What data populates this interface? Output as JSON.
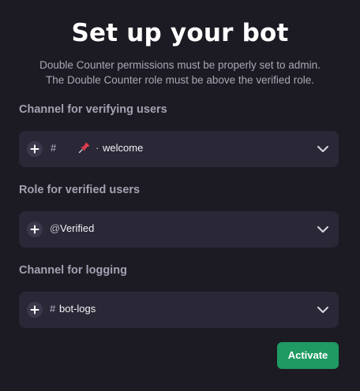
{
  "title": "Set up your bot",
  "description": {
    "line1": "Double Counter permissions must be properly set to admin.",
    "line2": "The Double Counter role must be above the verified role."
  },
  "fields": [
    {
      "label": "Channel for verifying users",
      "prefix": "#",
      "icon": "pushpin-emoji",
      "separator": "·",
      "value": "welcome"
    },
    {
      "label": "Role for verified users",
      "prefix": "@",
      "value": "Verified"
    },
    {
      "label": "Channel for logging",
      "prefix": "#",
      "value": "bot-logs"
    }
  ],
  "activate_label": "Activate",
  "colors": {
    "background": "#1c1b23",
    "field_bg": "#2a2837",
    "button_bg": "#1f9a62",
    "label": "#a3a2b2"
  }
}
